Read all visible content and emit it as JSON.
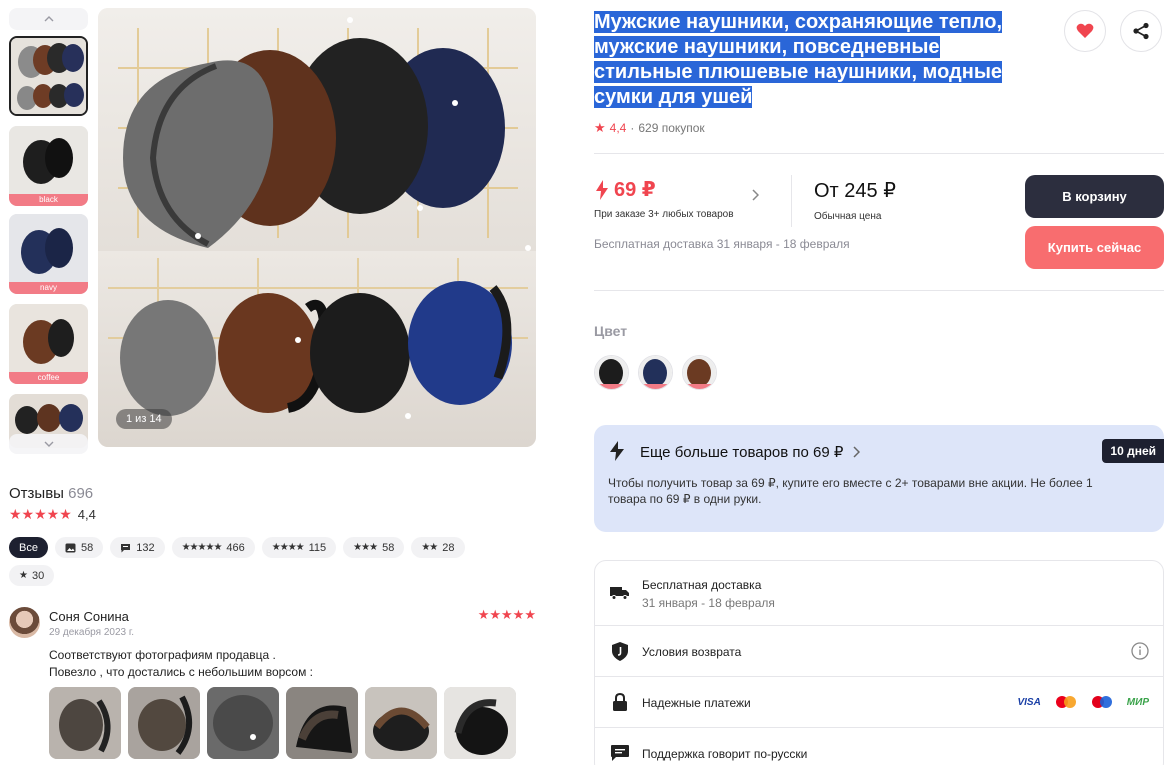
{
  "gallery": {
    "counter": "1 из 14",
    "thumb_tags": [
      "black",
      "navy",
      "coffee"
    ]
  },
  "reviews": {
    "title": "Отзывы",
    "count": "696",
    "rating_stars": "★★★★★",
    "rating": "4,4",
    "chips": [
      {
        "label": "Все",
        "stars": "",
        "count": ""
      },
      {
        "label": "",
        "stars": "",
        "count": "58",
        "icon": "photo-icon"
      },
      {
        "label": "",
        "stars": "",
        "count": "132",
        "icon": "comment-icon"
      },
      {
        "label": "",
        "stars": "★★★★★",
        "count": "466"
      },
      {
        "label": "",
        "stars": "★★★★",
        "count": "115"
      },
      {
        "label": "",
        "stars": "★★★",
        "count": "58"
      },
      {
        "label": "",
        "stars": "★★",
        "count": "28"
      },
      {
        "label": "",
        "stars": "★",
        "count": "30"
      }
    ],
    "item": {
      "author": "Соня Сонина",
      "date": "29 декабря 2023 г.",
      "stars": "★★★★★",
      "text": "Соответствуют фотографиям продавца .\nПовезло , что достались с небольшим ворсом :"
    }
  },
  "product": {
    "title": "Мужские наушники, сохраняющие тепло, мужские наушники, повседневные стильные плюшевые наушники, модные сумки для ушей",
    "rating_star": "★",
    "rating": "4,4",
    "dot": "·",
    "purchases": "629 покупок",
    "promo_price": "69 ₽",
    "promo_note": "При заказе 3+ любых товаров",
    "regular_price": "От 245 ₽",
    "regular_note": "Обычная цена",
    "delivery_note": "Бесплатная доставка 31 января - 18 февраля",
    "cart_button": "В корзину",
    "buy_button": "Купить сейчас",
    "color_label": "Цвет"
  },
  "promo": {
    "title": "Еще больше товаров по 69 ₽",
    "badge": "10 дней",
    "text": "Чтобы получить товар за 69 ₽, купите его вместе с 2+ товарами вне акции. Не более 1 товара по 69 ₽ в одни руки."
  },
  "info": {
    "delivery_label": "Бесплатная доставка",
    "delivery_dates": "31 января - 18 февраля",
    "returns_label": "Условия возврата",
    "payments_label": "Надежные платежи",
    "payment_visa": "VISA",
    "payment_mir": "МИР",
    "support_label": "Поддержка говорит по-русски"
  },
  "colors": {
    "accent_red": "#f0454f",
    "dark_button": "#2c2e3e",
    "buy_button": "#f86d6f",
    "promo_bg": "#dde5f9",
    "selection_blue": "#2a66d8"
  }
}
